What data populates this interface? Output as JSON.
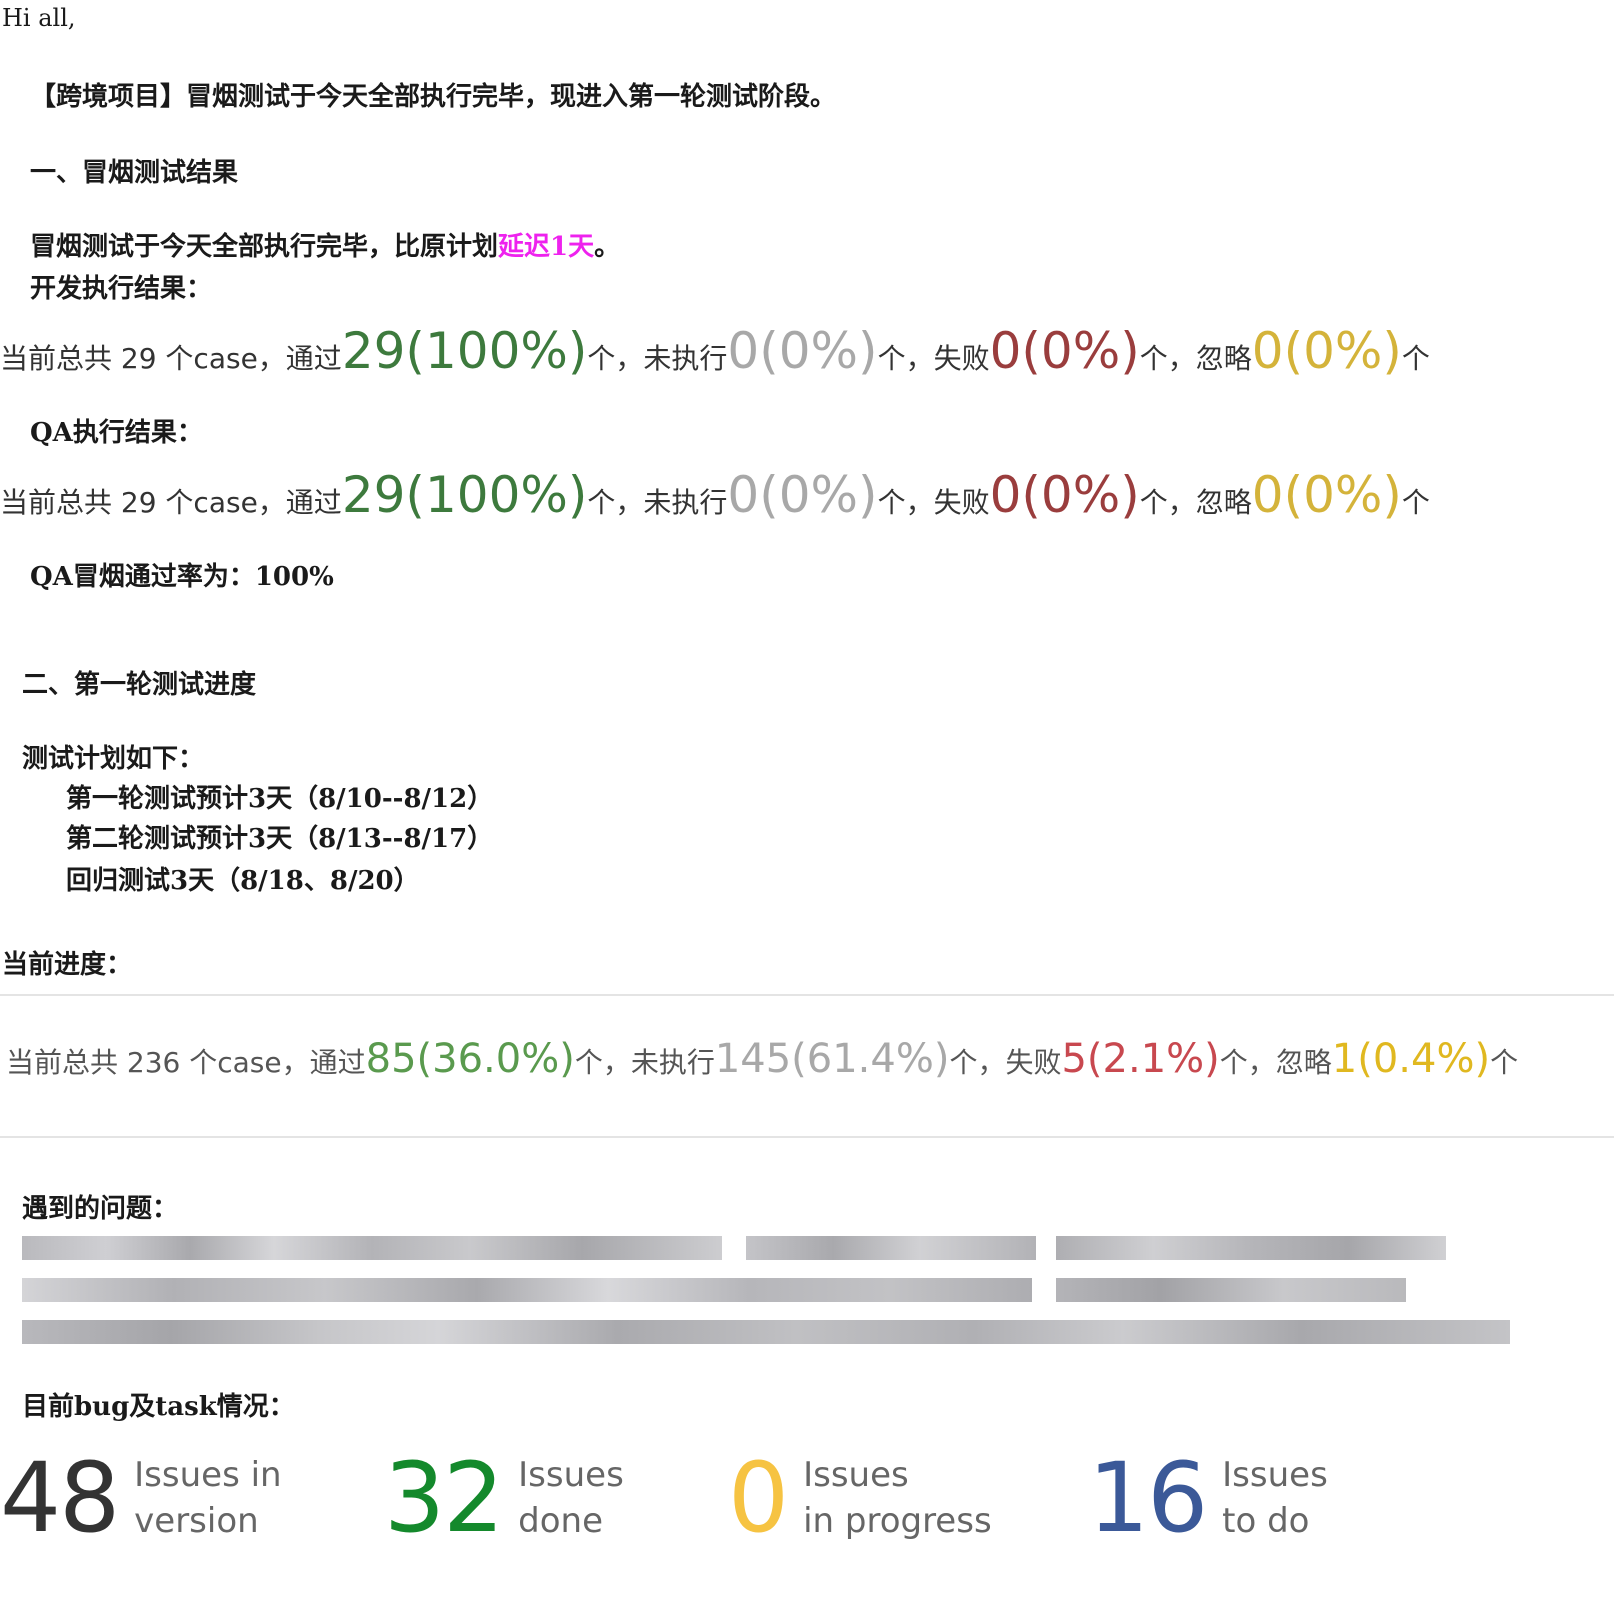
{
  "greeting": "Hi all,",
  "intro": "【跨境项目】冒烟测试于今天全部执行完毕，现进入第一轮测试阶段。",
  "section1": {
    "heading": "一、冒烟测试结果",
    "para_prefix": "冒烟测试于今天全部执行完毕，比原计划",
    "para_delay": "延迟1天",
    "para_suffix": "。",
    "dev_label": "开发执行结果：",
    "qa_label": "QA执行结果：",
    "qa_rate": "QA冒烟通过率为：100%"
  },
  "dev_stats": {
    "prefix": "当前总共 29 个case，通过",
    "pass": "29(100%)",
    "t1": "个，未执行",
    "notrun": "0(0%)",
    "t2": "个，失败",
    "fail": "0(0%)",
    "t3": "个，忽略",
    "ignore": "0(0%)",
    "t4": "个"
  },
  "qa_stats": {
    "prefix": "当前总共 29 个case，通过",
    "pass": "29(100%)",
    "t1": "个，未执行",
    "notrun": "0(0%)",
    "t2": "个，失败",
    "fail": "0(0%)",
    "t3": "个，忽略",
    "ignore": "0(0%)",
    "t4": "个"
  },
  "section2": {
    "heading": "二、第一轮测试进度",
    "plan_label": "测试计划如下：",
    "plan_items": [
      "第一轮测试预计3天（8/10--8/12）",
      "第二轮测试预计3天（8/13--8/17）",
      "回归测试3天（8/18、8/20）"
    ],
    "current_label": "当前进度："
  },
  "current_stats": {
    "prefix": "当前总共 236 个case，通过",
    "pass": "85(36.0%)",
    "t1": "个，未执行",
    "notrun": "145(61.4%)",
    "t2": "个，失败",
    "fail": "5(2.1%)",
    "t3": "个，忽略",
    "ignore": "1(0.4%)",
    "t4": "个"
  },
  "issues_label": "遇到的问题：",
  "bug_label": "目前bug及task情况：",
  "summary": [
    {
      "value": "48",
      "label": "Issues in\nversion",
      "color": "#333333"
    },
    {
      "value": "32",
      "label": "Issues\ndone",
      "color": "#14892c"
    },
    {
      "value": "0",
      "label": "Issues\nin progress",
      "color": "#f6c342"
    },
    {
      "value": "16",
      "label": "Issues\nto do",
      "color": "#3b5998"
    }
  ],
  "colors": {
    "pass": "#3d7a3d",
    "notrun": "#a8a8a8",
    "fail": "#9a3d3d",
    "ignore": "#d4b33a",
    "current_pass": "#5a9a4e",
    "current_fail": "#c8484f",
    "current_ignore": "#e0b820",
    "delay": "#ee22ee"
  }
}
